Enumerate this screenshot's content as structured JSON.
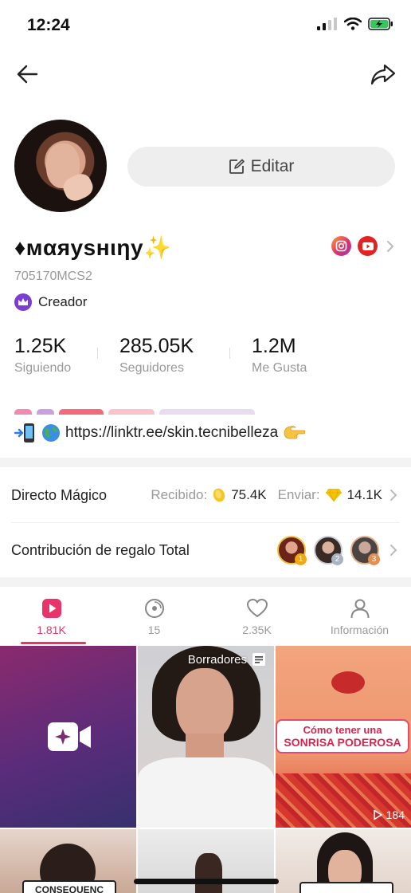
{
  "status_bar": {
    "time": "12:24"
  },
  "profile": {
    "edit_label": "Editar",
    "username": "♦мαяуѕнιηу✨",
    "user_id": "705170MCS2",
    "creator_label": "Creador",
    "bio": "https://linktr.ee/skin.tecnibelleza",
    "stats": [
      {
        "value": "1.25K",
        "label": "Siguiendo"
      },
      {
        "value": "285.05K",
        "label": "Seguidores"
      },
      {
        "value": "1.2M",
        "label": "Me Gusta"
      }
    ]
  },
  "rows": {
    "magic_live": {
      "title": "Directo Mágico",
      "received_label": "Recibido:",
      "received_value": "75.4K",
      "sent_label": "Enviar:",
      "sent_value": "14.1K"
    },
    "contribution": {
      "title": "Contribución de regalo Total",
      "ranks": [
        "1",
        "2",
        "3"
      ]
    }
  },
  "tabs": [
    {
      "label": "1.81K",
      "icon": "play-icon",
      "active": true
    },
    {
      "label": "15",
      "icon": "disc-icon",
      "active": false
    },
    {
      "label": "2.35K",
      "icon": "heart-icon",
      "active": false
    },
    {
      "label": "Información",
      "icon": "person-icon",
      "active": false
    }
  ],
  "grid": {
    "draft_label": "Borradores",
    "caption_line1": "Cómo tener una",
    "caption_line2": "SONRISA PODEROSA",
    "views": "184",
    "caption_bottom_left": "CONSEQUENC"
  },
  "colors": {
    "accent": "#e8336b",
    "muted": "#999999",
    "creator_badge": "#7a3fd1"
  }
}
